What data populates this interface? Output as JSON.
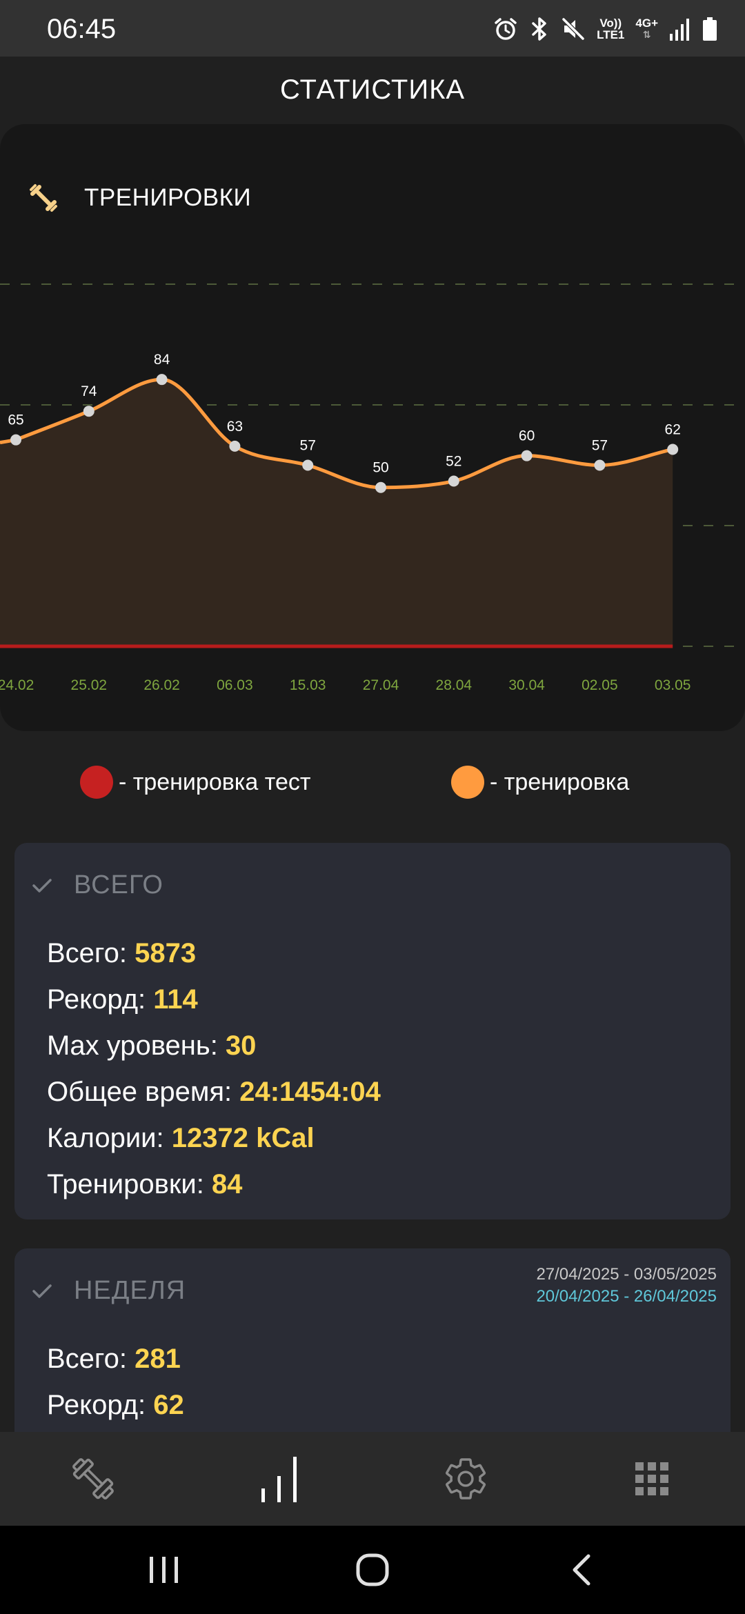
{
  "status_bar": {
    "time": "06:45",
    "network_volte": "Vo))",
    "network_lte": "LTE1",
    "network_4g": "4G+",
    "icons": [
      "alarm-icon",
      "bluetooth-icon",
      "mute-icon",
      "signal-icon",
      "battery-icon"
    ]
  },
  "header": {
    "title": "СТАТИСТИКА"
  },
  "chart_card": {
    "title": "ТРЕНИРОВКИ",
    "icon": "dumbbell-icon"
  },
  "chart_data": {
    "type": "area",
    "categories": [
      "24.02",
      "25.02",
      "26.02",
      "06.03",
      "15.03",
      "27.04",
      "28.04",
      "30.04",
      "02.05",
      "03.05"
    ],
    "series": [
      {
        "name": "- тренировка",
        "values": [
          65,
          74,
          84,
          63,
          57,
          50,
          52,
          60,
          57,
          62
        ],
        "color": "#ff9b3f"
      },
      {
        "name": "- тренировка тест",
        "values": [
          0,
          0,
          0,
          0,
          0,
          0,
          0,
          0,
          0,
          0
        ],
        "color": "#b71c1c"
      }
    ],
    "ylim": [
      0,
      114
    ],
    "grid": true,
    "data_labels": true,
    "legend_position": "bottom"
  },
  "legend": [
    {
      "label": "- тренировка тест",
      "color": "#c62121"
    },
    {
      "label": "- тренировка",
      "color": "#ff9b3f"
    }
  ],
  "total_card": {
    "title": "ВСЕГО",
    "rows": [
      {
        "label": "Всего: ",
        "value": "5873"
      },
      {
        "label": "Рекорд: ",
        "value": "114"
      },
      {
        "label": "Max уровень: ",
        "value": "30"
      },
      {
        "label": "Общее время: ",
        "value": "24:1454:04"
      },
      {
        "label": "Калории: ",
        "value": "12372 kCal"
      },
      {
        "label": "Тренировки: ",
        "value": "84"
      }
    ]
  },
  "week_card": {
    "title": "НЕДЕЛЯ",
    "range_current": "27/04/2025 - 03/05/2025",
    "range_previous": "20/04/2025 - 26/04/2025",
    "rows": [
      {
        "label": "Всего: ",
        "value": "281"
      },
      {
        "label": "Рекорд: ",
        "value": "62"
      }
    ]
  },
  "bottom_nav": {
    "items": [
      "workout-tab",
      "statistics-tab",
      "settings-tab",
      "apps-tab"
    ],
    "active": "statistics-tab"
  },
  "colors": {
    "accent_orange": "#ff9b3f",
    "accent_yellow": "#fdd451",
    "test_red": "#c62121",
    "date_green": "#7fa63f",
    "range_cyan": "#5fc7d9"
  }
}
